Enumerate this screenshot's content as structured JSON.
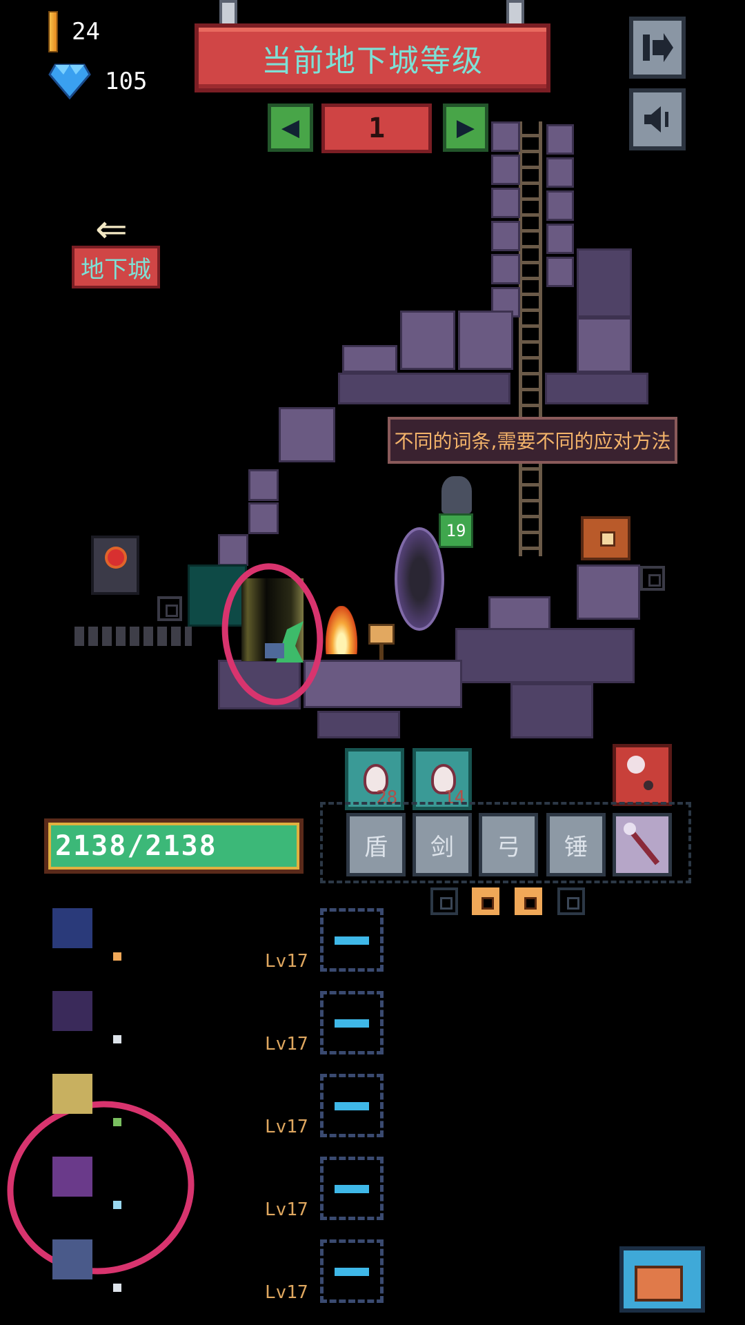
{
  "currency": {
    "gold": "24",
    "gems": "105"
  },
  "header": {
    "title": "当前地下城等级",
    "level": "1",
    "prev_icon": "◀",
    "next_icon": "▶"
  },
  "side_buttons": {
    "exit_icon": "exit-icon",
    "sound_icon": "sound-icon"
  },
  "nav": {
    "back_arrow": "⇐",
    "dungeon_label": "地下城"
  },
  "scene": {
    "tip": "不同的词条,需要不同的应对方法",
    "companion_level": "19"
  },
  "potions": [
    {
      "count": "28"
    },
    {
      "count": "14"
    }
  ],
  "weapons": [
    "盾",
    "剑",
    "弓",
    "锤"
  ],
  "hp": {
    "text": "2138/2138",
    "fraction": 1.0
  },
  "skills": [
    {
      "level": "Lv17",
      "pip_color": "#f0a858",
      "icon_color": "#2a3a7a"
    },
    {
      "level": "Lv17",
      "pip_color": "#dde3ea",
      "icon_color": "#3a2a5a"
    },
    {
      "level": "Lv17",
      "pip_color": "#7ac060",
      "icon_color": "#c8b060"
    },
    {
      "level": "Lv17",
      "pip_color": "#9ad8f0",
      "icon_color": "#6a3a8a"
    },
    {
      "level": "Lv17",
      "pip_color": "#dde3ea",
      "icon_color": "#4a5a8a"
    }
  ],
  "colors": {
    "banner_red": "#d04646",
    "title_teal": "#7ee0d6",
    "hp_green": "#3cb878",
    "annotation": "#d8346e"
  }
}
